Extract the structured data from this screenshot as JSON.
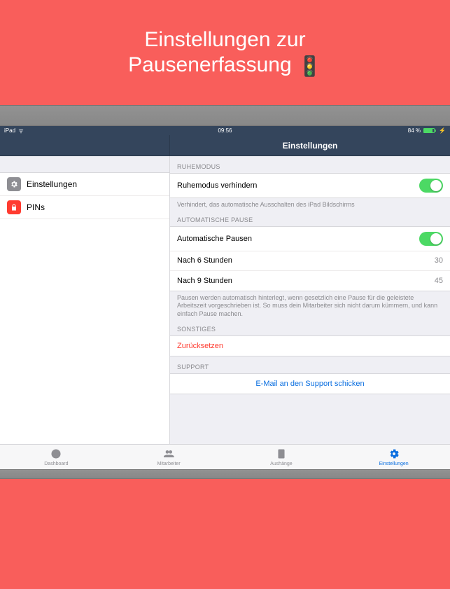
{
  "header": {
    "title_line1": "Einstellungen zur",
    "title_line2": "Pausenerfassung",
    "emoji": "🚦"
  },
  "statusbar": {
    "device": "iPad",
    "time": "09:56",
    "battery_text": "84 %"
  },
  "navbar": {
    "title": "Einstellungen"
  },
  "sidebar": {
    "items": [
      {
        "label": "Einstellungen",
        "icon": "gear"
      },
      {
        "label": "PINs",
        "icon": "lock"
      }
    ]
  },
  "detail": {
    "sections": {
      "sleep": {
        "header": "RUHEMODUS",
        "row_label": "Ruhemodus verhindern",
        "switch_on": true,
        "footer": "Verhindert, das automatische Ausschalten des iPad Bildschirms"
      },
      "autopause": {
        "header": "AUTOMATISCHE PAUSE",
        "rows": [
          {
            "label": "Automatische Pausen",
            "type": "switch",
            "on": true
          },
          {
            "label": "Nach 6 Stunden",
            "type": "value",
            "value": "30"
          },
          {
            "label": "Nach 9 Stunden",
            "type": "value",
            "value": "45"
          }
        ],
        "footer": "Pausen werden automatisch hinterlegt, wenn gesetzlich eine Pause für die geleistete Arbeitszeit vorgeschrieben ist. So muss dein Mitarbeiter sich nicht darum kümmern, und kann einfach Pause machen."
      },
      "other": {
        "header": "SONSTIGES",
        "reset_label": "Zurücksetzen"
      },
      "support": {
        "header": "SUPPORT",
        "link_label": "E-Mail an den Support schicken"
      }
    }
  },
  "tabbar": {
    "tabs": [
      {
        "label": "Dashboard",
        "icon": "menu-circle",
        "active": false
      },
      {
        "label": "Mitarbeiter",
        "icon": "people",
        "active": false
      },
      {
        "label": "Aushänge",
        "icon": "document",
        "active": false
      },
      {
        "label": "Einstellungen",
        "icon": "gear",
        "active": true
      }
    ]
  }
}
